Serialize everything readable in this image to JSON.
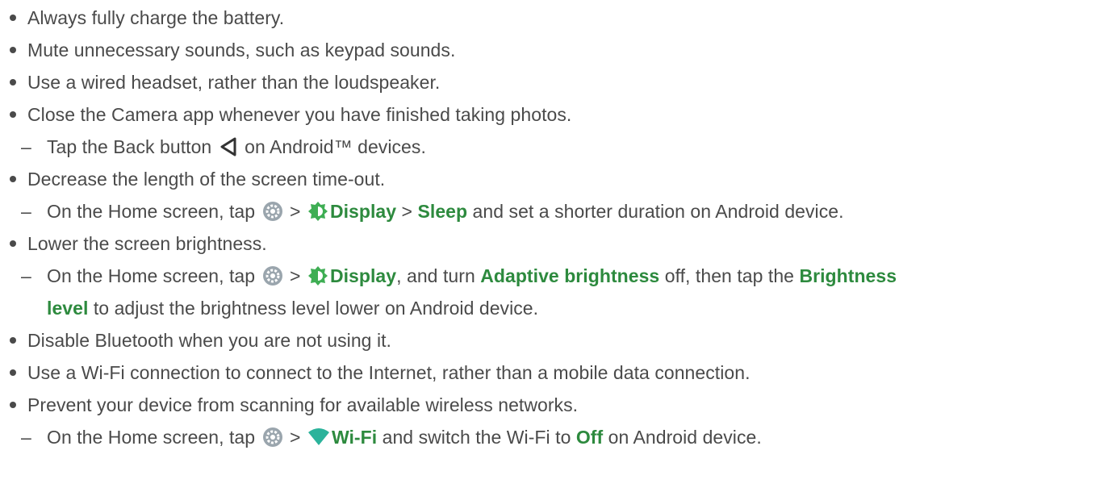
{
  "bullets": {
    "b1": "Always fully charge the battery.",
    "b2": "Mute unnecessary sounds, such as keypad sounds.",
    "b3": "Use a wired headset, rather than the loudspeaker.",
    "b4": "Close the Camera app whenever you have finished taking photos.",
    "b5": "Decrease the length of the screen time-out.",
    "b6": "Lower the screen brightness.",
    "b7": "Disable Bluetooth when you are not using it.",
    "b8": "Use a Wi-Fi connection to connect to the Internet, rather than a mobile data connection.",
    "b9": "Prevent your device from scanning for available wireless networks."
  },
  "sub": {
    "s1_dash": "–",
    "s1_a": "Tap the Back button ",
    "s1_b": " on Android™ devices.",
    "s2_dash": "–",
    "s2_a": "On the Home screen, tap ",
    "s2_gt1": " > ",
    "s2_display": "Display",
    "s2_gt2": " > ",
    "s2_sleep": "Sleep",
    "s2_b": " and set a shorter duration on Android device.",
    "s3_dash": "–",
    "s3_a": "On the Home screen, tap ",
    "s3_gt1": " > ",
    "s3_display": "Display",
    "s3_b": ", and turn ",
    "s3_adaptive": "Adaptive brightness",
    "s3_c": " off, then tap the ",
    "s3_brightness": "Brightness",
    "s3_level": "level",
    "s3_d": " to adjust the brightness level lower on Android device.",
    "s4_dash": "–",
    "s4_a": "On the Home screen, tap ",
    "s4_gt1": " > ",
    "s4_wifi": "Wi-Fi",
    "s4_b": " and switch the Wi-Fi to ",
    "s4_off": "Off",
    "s4_c": " on Android device."
  },
  "icons": {
    "back": "back-triangle-icon",
    "settings": "settings-gear-icon",
    "display": "display-brightness-icon",
    "wifi": "wifi-icon"
  },
  "colors": {
    "text": "#4a4a4a",
    "accent_green": "#2d8a3e",
    "settings_icon_bg": "#9aa5ad",
    "display_icon": "#3fae54",
    "wifi_icon": "#2bb39b"
  }
}
